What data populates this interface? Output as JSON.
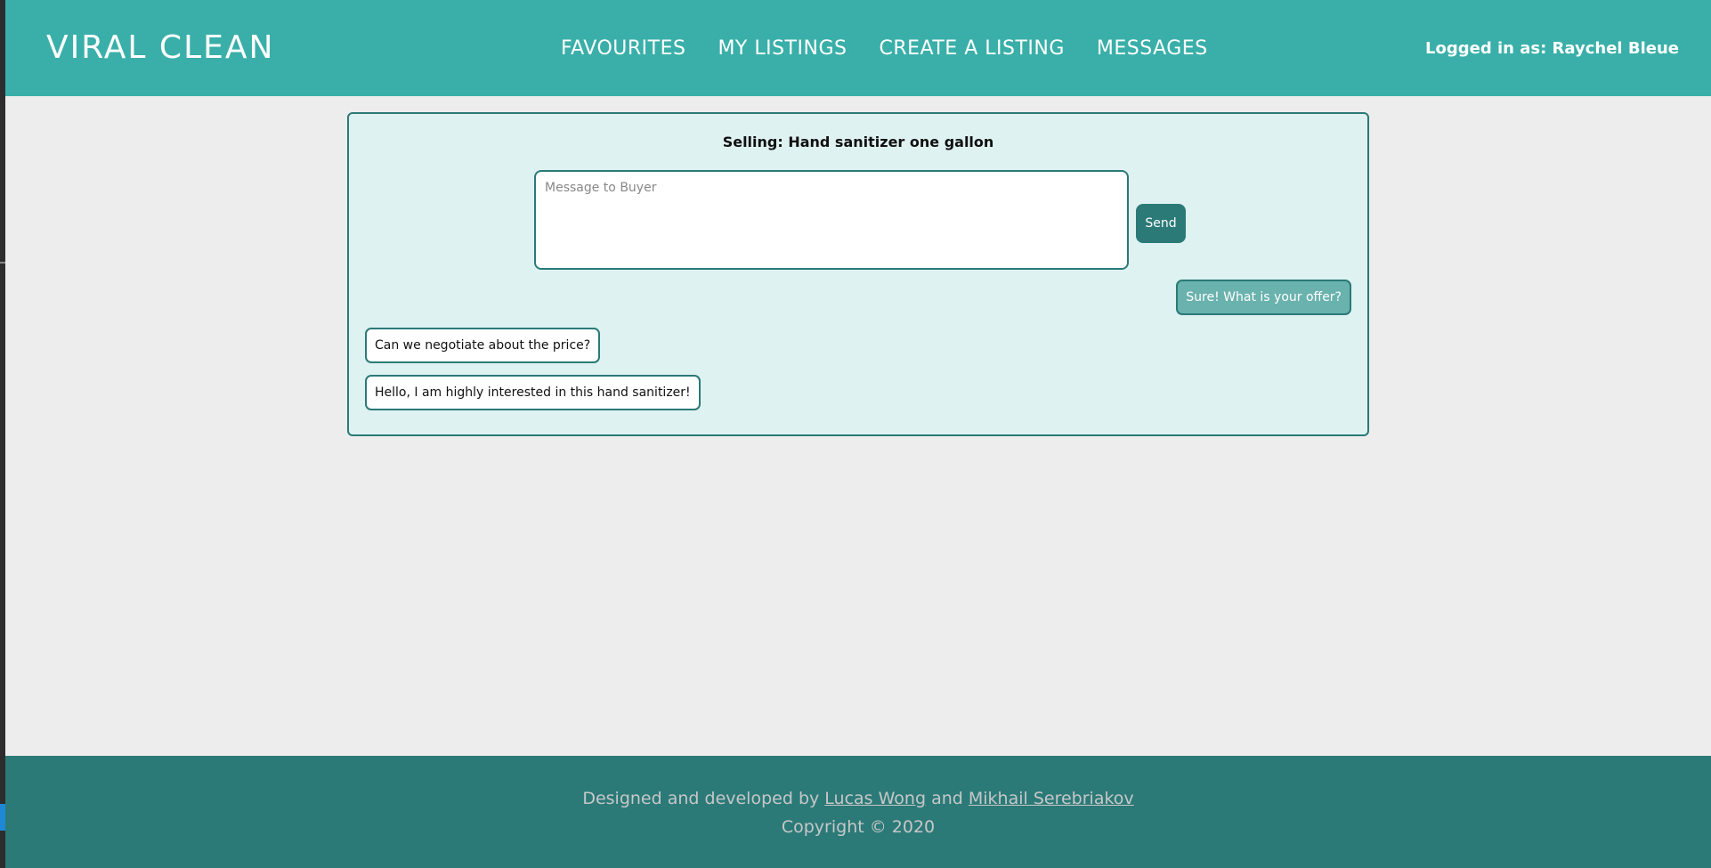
{
  "header": {
    "brand": "VIRAL CLEAN",
    "nav": [
      {
        "label": "FAVOURITES"
      },
      {
        "label": "MY LISTINGS"
      },
      {
        "label": "CREATE A LISTING"
      },
      {
        "label": "MESSAGES"
      }
    ],
    "user_label": "Logged in as: Raychel Bleue"
  },
  "chat": {
    "title": "Selling: Hand sanitizer one gallon",
    "input": {
      "placeholder": "Message to Buyer",
      "value": ""
    },
    "send_label": "Send",
    "messages": [
      {
        "direction": "outgoing",
        "text": "Sure! What is your offer?"
      },
      {
        "direction": "incoming",
        "text": "Can we negotiate about the price?"
      },
      {
        "direction": "incoming",
        "text": "Hello, I am highly interested in this hand sanitizer!"
      }
    ]
  },
  "footer": {
    "prefix": "Designed and developed by",
    "author1": "Lucas Wong",
    "conjunction": "and",
    "author2": "Mikhail Serebriakov",
    "copyright": "Copyright © 2020"
  },
  "colors": {
    "header_bg": "#3aafa9",
    "footer_bg": "#2b7a78",
    "panel_bg": "#def2f1",
    "accent": "#2b7a78",
    "page_bg": "#ededed"
  }
}
